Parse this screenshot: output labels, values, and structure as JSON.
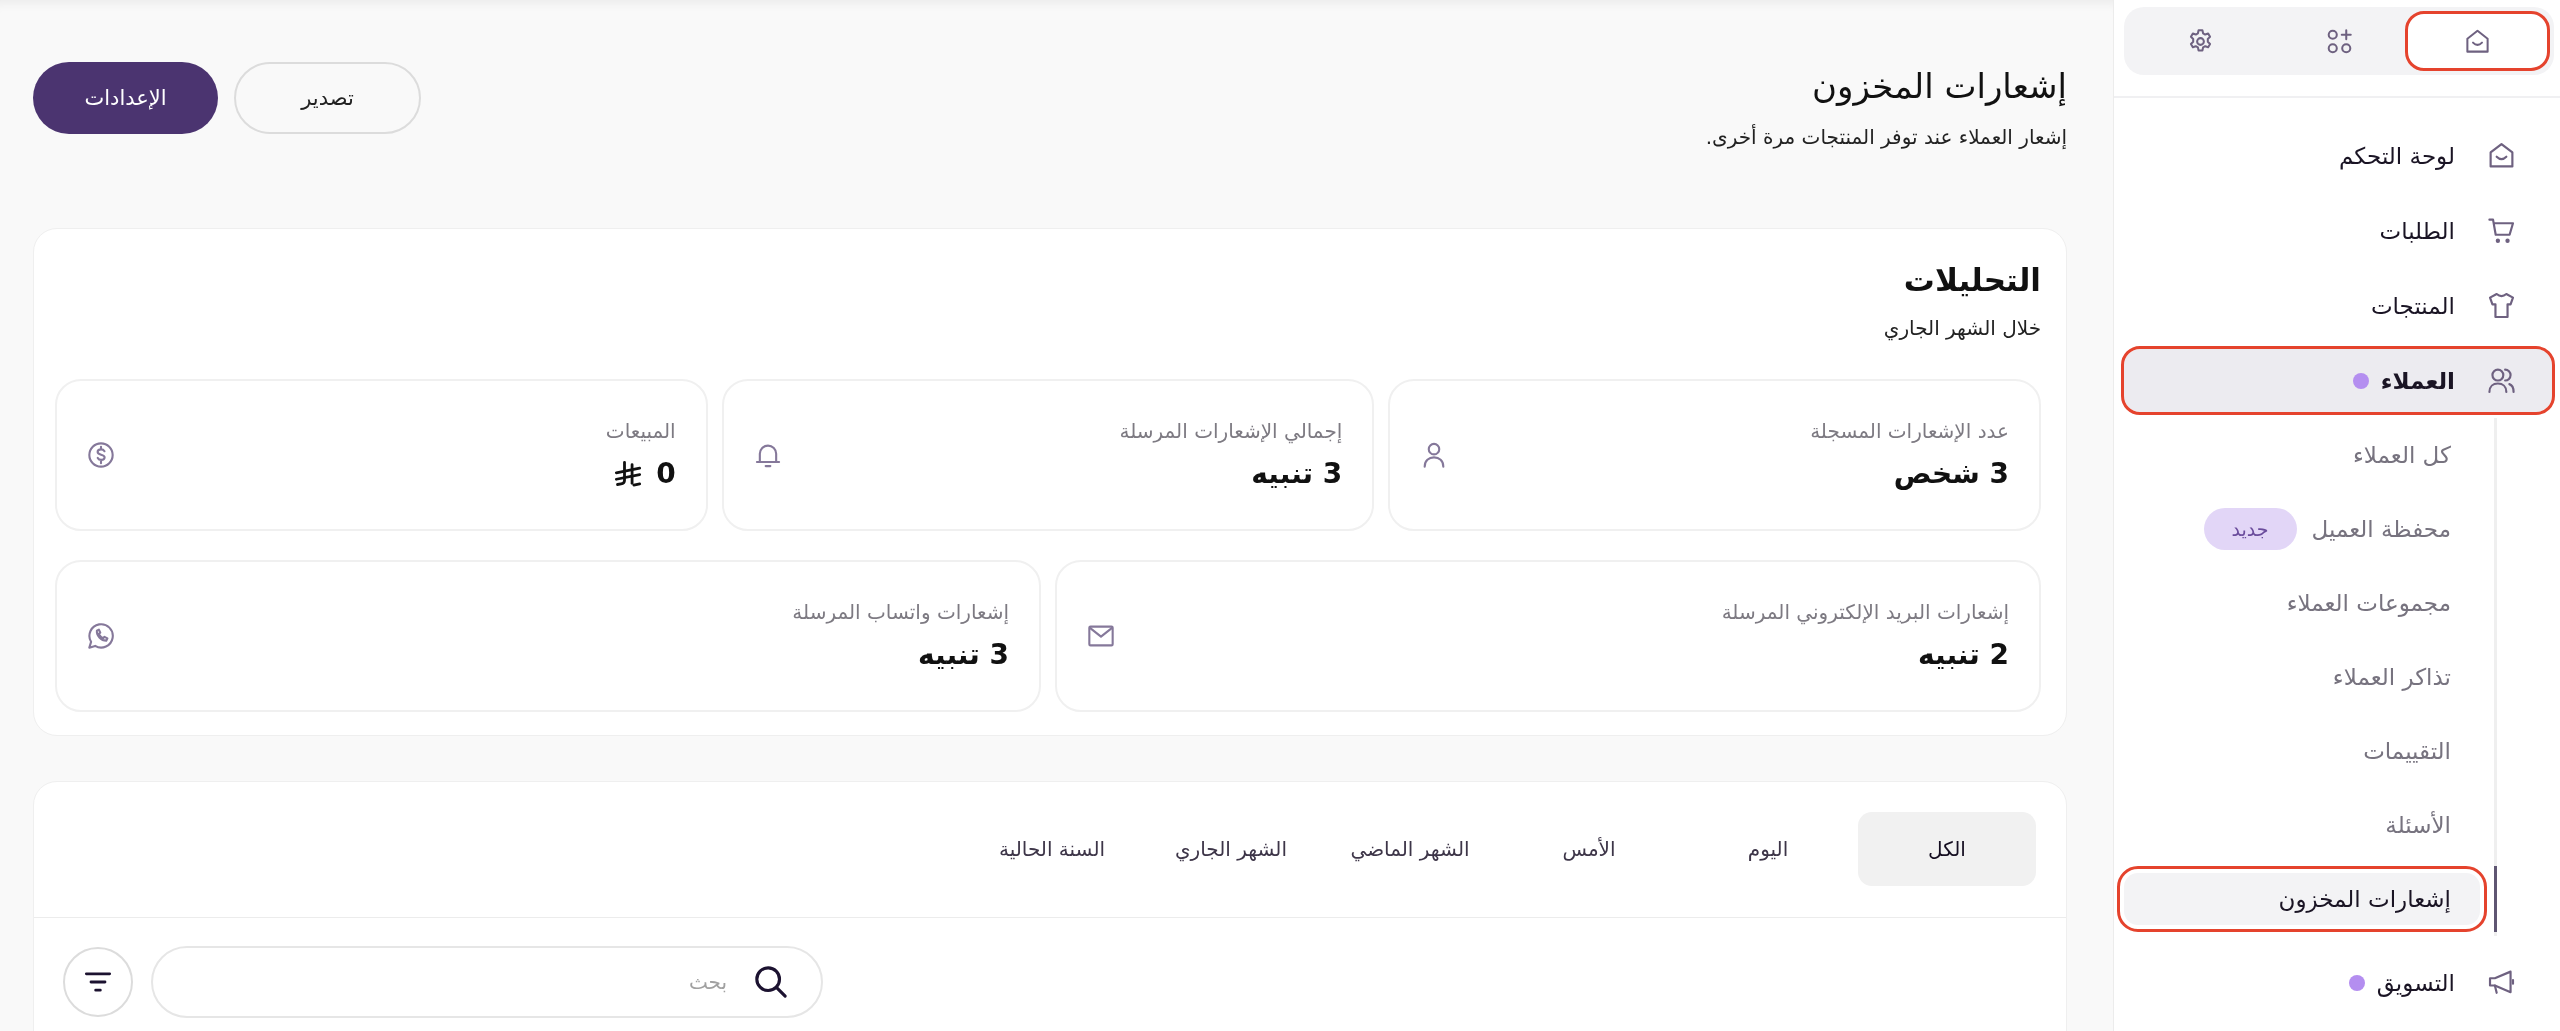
{
  "sidebar": {
    "top_tabs": [
      {
        "selected": true,
        "highlighted": true
      },
      {
        "selected": false,
        "highlighted": false
      },
      {
        "selected": false,
        "highlighted": false
      }
    ],
    "items": [
      {
        "label": "لوحة التحكم",
        "selected": false,
        "highlighted": false,
        "dot": false
      },
      {
        "label": "الطلبات",
        "selected": false,
        "highlighted": false,
        "dot": false
      },
      {
        "label": "المنتجات",
        "selected": false,
        "highlighted": false,
        "dot": false
      },
      {
        "label": "العملاء",
        "selected": true,
        "highlighted": true,
        "dot": true,
        "children": [
          {
            "label": "كل العملاء",
            "selected": false,
            "highlighted": false
          },
          {
            "label": "محفظة العميل",
            "badge": "جديد",
            "selected": false,
            "highlighted": false
          },
          {
            "label": "مجموعات العملاء",
            "selected": false,
            "highlighted": false
          },
          {
            "label": "تذاكر العملاء",
            "selected": false,
            "highlighted": false
          },
          {
            "label": "التقييمات",
            "selected": false,
            "highlighted": false
          },
          {
            "label": "الأسئلة",
            "selected": false,
            "highlighted": false
          },
          {
            "label": "إشعارات المخزون",
            "selected": true,
            "highlighted": true
          }
        ]
      },
      {
        "label": "التسويق",
        "selected": false,
        "highlighted": false,
        "dot": true
      }
    ]
  },
  "header": {
    "title": "إشعارات المخزون",
    "subtitle": "إشعار العملاء عند توفر المنتجات مرة أخرى.",
    "buttons": [
      {
        "label": "تصدير",
        "kind": "secondary"
      },
      {
        "label": "الإعدادات",
        "kind": "primary"
      }
    ]
  },
  "analytics": {
    "title": "التحليلات",
    "subtitle": "خلال الشهر الجاري",
    "stat_rows": [
      [
        {
          "label": "عدد الإشعارات المسجلة",
          "value": "3 شخص",
          "kind": "count"
        },
        {
          "label": "إجمالي الإشعارات المرسلة",
          "value": "3 تنبيه",
          "kind": "count"
        },
        {
          "label": "المبيعات",
          "value": "0",
          "kind": "money"
        }
      ],
      [
        {
          "label": "إشعارات البريد الإلكتروني المرسلة",
          "value": "2 تنبيه",
          "kind": "count"
        },
        {
          "label": "إشعارات واتساب المرسلة",
          "value": "3 تنبيه",
          "kind": "count"
        }
      ]
    ]
  },
  "notifications": {
    "period_tabs": [
      {
        "label": "الكل",
        "selected": true
      },
      {
        "label": "اليوم",
        "selected": false
      },
      {
        "label": "الأمس",
        "selected": false
      },
      {
        "label": "الشهر الماضي",
        "selected": false
      },
      {
        "label": "الشهر الجاري",
        "selected": false
      },
      {
        "label": "السنة الحالية",
        "selected": false
      }
    ],
    "search": {
      "placeholder": "بحث"
    }
  }
}
